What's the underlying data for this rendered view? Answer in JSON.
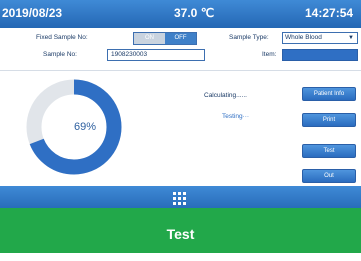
{
  "statusbar": {
    "date": "2019/08/23",
    "temperature": "37.0 ℃",
    "time": "14:27:54"
  },
  "form": {
    "fixed_sample_label": "Fixed Sample No:",
    "toggle_on": "ON",
    "toggle_off": "OFF",
    "sample_type_label": "Sample Type:",
    "sample_type_value": "Whole Blood",
    "sample_no_label": "Sample No:",
    "sample_no_value": "1908230003",
    "item_label": "Item:",
    "item_value": ""
  },
  "status": {
    "calculating": "Calculating......",
    "testing": "Testing···",
    "progress_percent": 69,
    "progress_text": "69%"
  },
  "buttons": {
    "patient_info": "Patient Info",
    "print": "Print",
    "test": "Test",
    "out": "Out"
  },
  "colors": {
    "accent": "#2f6fc4",
    "caption_bg": "#22a84a"
  },
  "icons": {
    "menu": "grid-menu-icon"
  },
  "caption": {
    "label": "Test"
  }
}
